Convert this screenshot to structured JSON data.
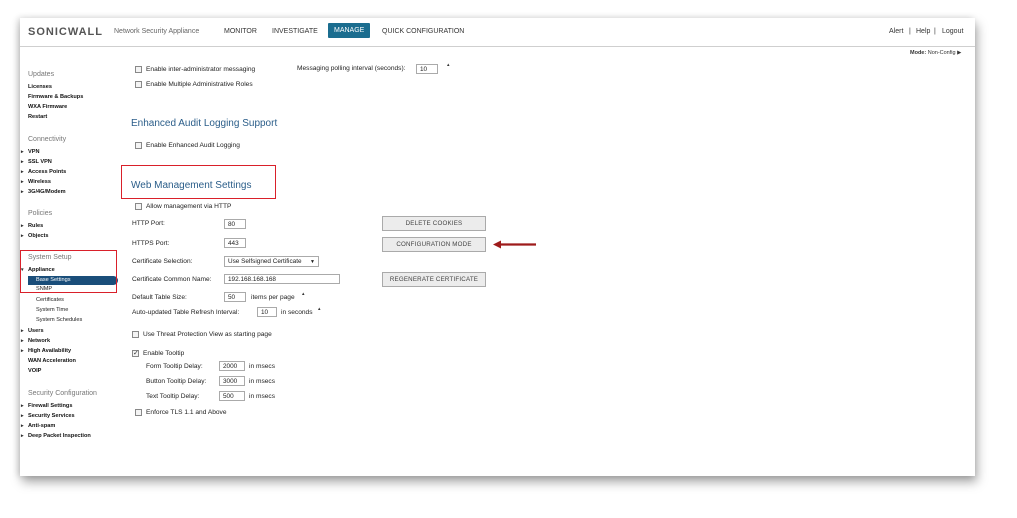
{
  "header": {
    "logo": "SONICWALL",
    "subtitle": "Network Security Appliance",
    "nav": [
      "MONITOR",
      "INVESTIGATE",
      "MANAGE",
      "QUICK CONFIGURATION"
    ],
    "active_nav": "MANAGE",
    "alert": "Alert",
    "help": "Help",
    "logout": "Logout",
    "sep": "|",
    "mode_label": "Mode:",
    "mode_value": "Non-Config ▶"
  },
  "sidebar": {
    "updates": {
      "title": "Updates",
      "items": [
        "Licenses",
        "Firmware & Backups",
        "WXA Firmware",
        "Restart"
      ]
    },
    "connectivity": {
      "title": "Connectivity",
      "items": [
        "VPN",
        "SSL VPN",
        "Access Points",
        "Wireless",
        "3G/4G/Modem"
      ]
    },
    "policies": {
      "title": "Policies",
      "items": [
        "Rules",
        "Objects"
      ]
    },
    "system_setup": {
      "title": "System Setup",
      "appliance": "Appliance",
      "selected": "Base Settings",
      "subitems": [
        "SNMP",
        "Certificates",
        "System Time",
        "System Schedules"
      ],
      "items": [
        "Users",
        "Network",
        "High Availability",
        "WAN Acceleration",
        "VOIP"
      ]
    },
    "security": {
      "title": "Security Configuration",
      "items": [
        "Firewall Settings",
        "Security Services",
        "Anti-spam",
        "Deep Packet Inspection"
      ]
    }
  },
  "main": {
    "inter_admin_msg": "Enable inter-administrator messaging",
    "polling_label": "Messaging polling interval (seconds):",
    "polling_value": "10",
    "multiple_roles": "Enable Multiple Administrative Roles",
    "audit_heading": "Enhanced Audit Logging Support",
    "enable_audit": "Enable Enhanced Audit Logging",
    "web_heading": "Web Management Settings",
    "allow_http": "Allow management via HTTP",
    "http_port_label": "HTTP Port:",
    "http_port": "80",
    "https_port_label": "HTTPS Port:",
    "https_port": "443",
    "cert_sel_label": "Certificate Selection:",
    "cert_sel_value": "Use Selfsigned Certificate",
    "cert_cn_label": "Certificate Common Name:",
    "cert_cn": "192.168.168.168",
    "table_size_label": "Default Table Size:",
    "table_size": "50",
    "table_size_unit": "items per page",
    "refresh_label": "Auto-updated Table Refresh Interval:",
    "refresh_value": "10",
    "refresh_unit": "in seconds",
    "threat_view": "Use Threat Protection View as starting page",
    "enable_tooltip": "Enable Tooltip",
    "form_delay_label": "Form Tooltip Delay:",
    "form_delay": "2000",
    "button_delay_label": "Button Tooltip Delay:",
    "button_delay": "3000",
    "text_delay_label": "Text Tooltip Delay:",
    "text_delay": "500",
    "msecs": "in msecs",
    "enforce_tls": "Enforce TLS 1.1 and Above",
    "btn_delete_cookies": "DELETE COOKIES",
    "btn_config_mode": "CONFIGURATION MODE",
    "btn_regen_cert": "REGENERATE CERTIFICATE"
  },
  "colors": {
    "accent": "#1b6d8f",
    "highlight": "#d9202a",
    "heading": "#2a5d89",
    "arrow": "#9e1b1b"
  },
  "icons": {
    "annotation_arrow": "left-arrow-icon"
  }
}
